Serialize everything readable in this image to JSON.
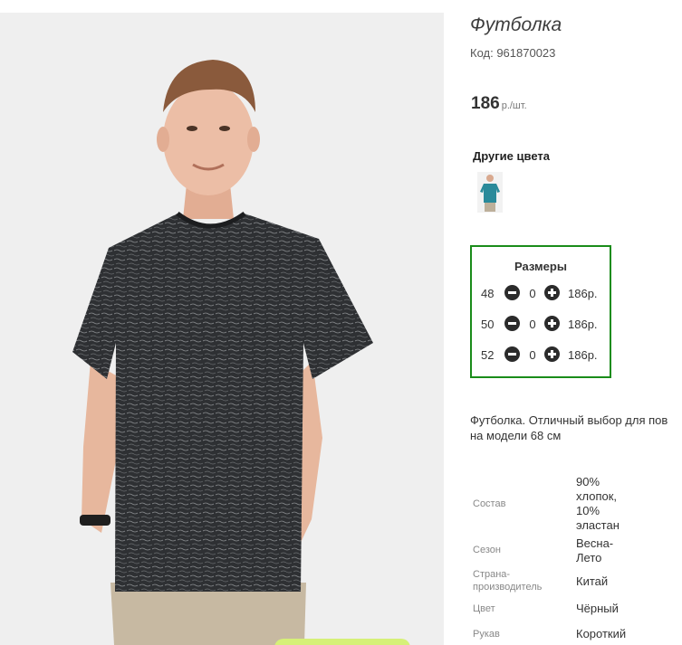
{
  "product": {
    "title": "Футболка",
    "code": "Код: 961870023",
    "price": "186",
    "price_unit": "р./шт."
  },
  "other_colors": {
    "heading": "Другие цвета",
    "swatches": [
      {
        "color": "#2a8a9a"
      }
    ]
  },
  "sizes": {
    "heading": "Размеры",
    "rows": [
      {
        "size": "48",
        "qty": "0",
        "price": "186р."
      },
      {
        "size": "50",
        "qty": "0",
        "price": "186р."
      },
      {
        "size": "52",
        "qty": "0",
        "price": "186р."
      }
    ],
    "border_color": "#1a8c1a"
  },
  "description": {
    "line1": "Футболка. Отличный выбор для пов",
    "line2": "на модели 68 см"
  },
  "specs": [
    {
      "label": "Состав",
      "value_lines": [
        "90%",
        "хлопок,",
        "10%",
        "эластан"
      ]
    },
    {
      "label_lines": [
        "Сезон"
      ],
      "value_lines": [
        "Весна-",
        "Лето"
      ]
    },
    {
      "label_lines": [
        "Страна-",
        "производитель"
      ],
      "value_lines": [
        "Китай"
      ]
    },
    {
      "label_lines": [
        "Цвет"
      ],
      "value_lines": [
        "Чёрный"
      ]
    },
    {
      "label_lines": [
        "Рукав"
      ],
      "value_lines": [
        "Короткий"
      ]
    }
  ],
  "colors": {
    "shirt": "#2e3033",
    "accent_button": "#d6f078"
  }
}
